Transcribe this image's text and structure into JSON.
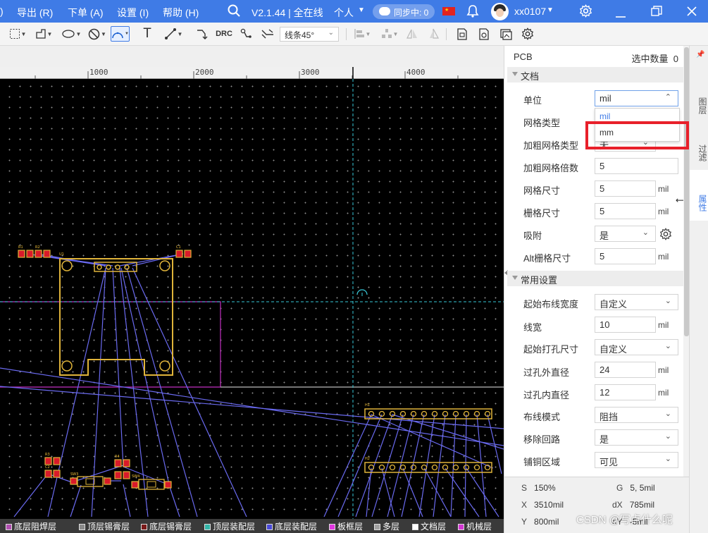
{
  "menu": {
    "items": [
      ")",
      "导出 (R)",
      "下单 (A)",
      "设置 (I)",
      "帮助 (H)"
    ],
    "version": "V2.1.44 | 全在线",
    "mode": "个人",
    "sync": "同步中: 0",
    "user": "xx0107"
  },
  "toolbar": {
    "route_mode": "线条45°",
    "drc_label": "DRC"
  },
  "ruler": {
    "labels": [
      "1000",
      "2000",
      "3000",
      "4000"
    ]
  },
  "board": {
    "component_labels": [
      "R1",
      "R2",
      "U1",
      "C1",
      "H1",
      "H2",
      "R3",
      "C2",
      "SW3",
      "R4",
      "SW4"
    ]
  },
  "layers": [
    {
      "name": "底层阻焊层",
      "color": "#b04fb0"
    },
    {
      "name": "顶层锡膏层",
      "color": "#8a8a8a"
    },
    {
      "name": "底层锡膏层",
      "color": "#7a1a1a"
    },
    {
      "name": "顶层装配层",
      "color": "#33b5a8"
    },
    {
      "name": "底层装配层",
      "color": "#4a4ad8"
    },
    {
      "name": "板框层",
      "color": "#e036e0"
    },
    {
      "name": "多层",
      "color": "#a0a0a0"
    },
    {
      "name": "文档层",
      "color": "#ffffff"
    },
    {
      "name": "机械层",
      "color": "#d336d3"
    }
  ],
  "panel": {
    "title": "PCB",
    "selected_count_label": "选中数量",
    "selected_count": "0",
    "section_doc": "文档",
    "unit_label": "单位",
    "unit_value": "mil",
    "unit_options": [
      "mil",
      "mm"
    ],
    "grid_type_label": "网格类型",
    "bold_grid_type_label": "加粗网格类型",
    "bold_grid_type_value": "无",
    "bold_grid_multiple_label": "加粗网格倍数",
    "bold_grid_multiple_value": "5",
    "grid_size_label": "网格尺寸",
    "grid_size_value": "5",
    "grid_size_unit": "mil",
    "snap_grid_label": "栅格尺寸",
    "snap_grid_value": "5",
    "snap_grid_unit": "mil",
    "snap_label": "吸附",
    "snap_value": "是",
    "alt_grid_label": "Alt栅格尺寸",
    "alt_grid_value": "5",
    "alt_grid_unit": "mil",
    "section_common": "常用设置",
    "route_width_label": "起始布线宽度",
    "route_width_value": "自定义",
    "line_width_label": "线宽",
    "line_width_value": "10",
    "line_width_unit": "mil",
    "via_size_label": "起始打孔尺寸",
    "via_size_value": "自定义",
    "via_outer_label": "过孔外直径",
    "via_outer_value": "24",
    "via_outer_unit": "mil",
    "via_inner_label": "过孔内直径",
    "via_inner_value": "12",
    "via_inner_unit": "mil",
    "route_mode_label": "布线模式",
    "route_mode_value": "阻挡",
    "remove_loop_label": "移除回路",
    "remove_loop_value": "是",
    "copper_area_label": "铺铜区域",
    "copper_area_value": "可见"
  },
  "status": {
    "s_label": "S",
    "s_value": "150%",
    "g_label": "G",
    "g_value": "5, 5mil",
    "x_label": "X",
    "x_value": "3510mil",
    "dx_label": "dX",
    "dx_value": "785mil",
    "y_label": "Y",
    "y_value": "800mil",
    "dy_label": "dY",
    "dy_value": "-5mil"
  },
  "side_tabs": [
    "图层",
    "过滤",
    "属性"
  ],
  "watermark": "CSDN @写点什么呢",
  "icons": [
    "search-icon",
    "chevron-down-icon",
    "cloud-icon",
    "flag-icon",
    "bell-icon",
    "avatar",
    "gear-icon",
    "minimize-icon",
    "restore-icon",
    "close-icon"
  ]
}
